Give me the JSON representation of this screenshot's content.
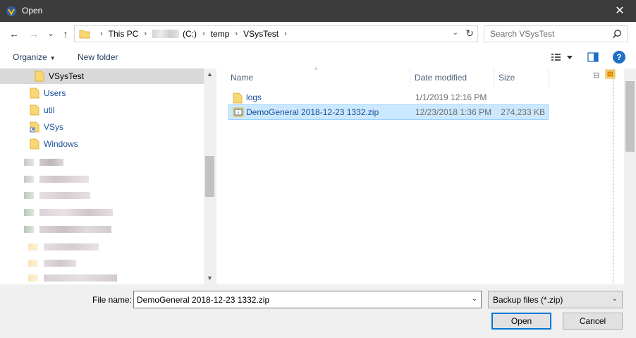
{
  "window": {
    "title": "Open",
    "close_glyph": "✕"
  },
  "nav_buttons": {
    "back": "←",
    "forward": "→",
    "recent": "⌄",
    "up": "↑"
  },
  "address": {
    "crumbs": [
      "This PC",
      "(C:)",
      "temp",
      "VSysTest"
    ],
    "dropdown_glyph": "⌄",
    "refresh_glyph": "↻"
  },
  "search": {
    "placeholder": "Search VSysTest"
  },
  "toolbar": {
    "organize_label": "Organize",
    "new_folder_label": "New folder",
    "help_label": "?"
  },
  "sidebar": {
    "items": [
      {
        "label": "VSysTest",
        "icon": "folder-icon",
        "selected": true
      },
      {
        "label": "Users",
        "icon": "folder-icon"
      },
      {
        "label": "util",
        "icon": "folder-icon"
      },
      {
        "label": "VSys",
        "icon": "shortcut-folder-icon"
      },
      {
        "label": "Windows",
        "icon": "folder-icon"
      }
    ],
    "scroll_up": "▲",
    "scroll_down": "▼"
  },
  "file_list": {
    "columns": [
      "Name",
      "Date modified",
      "Size"
    ],
    "rows": [
      {
        "name": "logs",
        "date": "1/1/2019 12:16 PM",
        "size": "",
        "icon": "folder-icon"
      },
      {
        "name": "DemoGeneral 2018-12-23 1332.zip",
        "date": "12/23/2018 1:36 PM",
        "size": "274,233 KB",
        "icon": "zip-icon",
        "selected": true
      }
    ]
  },
  "preview": {
    "collapse_glyph": "⊟"
  },
  "bottom": {
    "file_name_label": "File name:",
    "file_name_value": "DemoGeneral 2018-12-23 1332.zip",
    "filter_value": "Backup files (*.zip)",
    "dropdown_glyph": "⌄",
    "open_label": "Open",
    "cancel_label": "Cancel"
  },
  "colors": {
    "titlebar": "#3c3c3c",
    "link": "#1a4e99",
    "selection": "#cce8ff",
    "accent": "#0078d7",
    "folder": "#f8d775"
  }
}
